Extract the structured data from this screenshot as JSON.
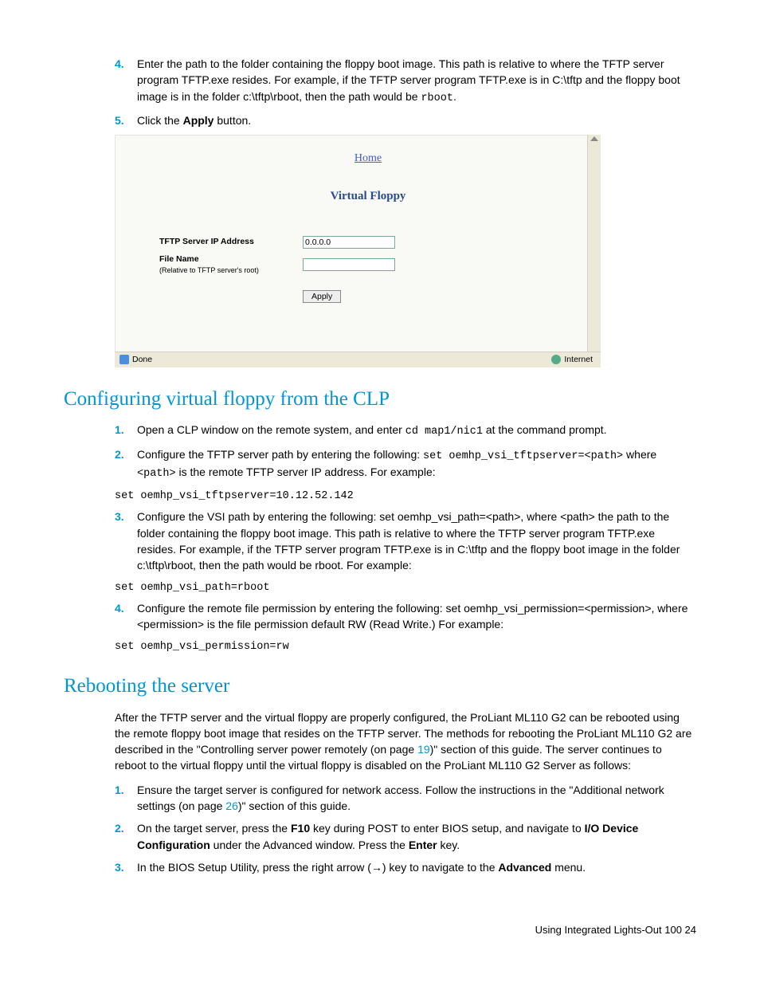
{
  "top": {
    "item4_a": "Enter the path to the folder containing the floppy boot image. This path is relative to where the TFTP server program TFTP.exe resides. For example, if the TFTP server program TFTP.exe is in C:\\tftp and the floppy boot image is in the folder c:\\tftp\\rboot, then the path would be ",
    "item4_code": "rboot",
    "item4_b": ".",
    "item5_a": "Click the ",
    "item5_bold": "Apply",
    "item5_b": " button."
  },
  "embed": {
    "home": "Home",
    "title": "Virtual Floppy",
    "label_ip": "TFTP Server IP Address",
    "label_file": "File Name",
    "label_file_sub": "(Relative to TFTP server's root)",
    "ip_value": "0.0.0.0",
    "apply": "Apply",
    "status_left": "Done",
    "status_right": "Internet"
  },
  "h2a": "Configuring virtual floppy from the CLP",
  "clp": {
    "i1a": "Open a CLP window on the remote system, and enter ",
    "i1code": "cd map1/nic1",
    "i1b": " at the command prompt.",
    "i2a": "Configure the TFTP server path by entering the following: ",
    "i2code": "set oemhp_vsi_tftpserver=<path>",
    "i2b": " where ",
    "i2code2": "<path>",
    "i2c": " is the remote TFTP server IP address. For example:",
    "code1": "set oemhp_vsi_tftpserver=10.12.52.142",
    "i3": "Configure the VSI path by entering the following: set oemhp_vsi_path=<path>,  where <path> the path to the folder containing the floppy boot image. This path is relative to where the TFTP server program TFTP.exe resides. For example, if the TFTP server program TFTP.exe is in C:\\tftp and the floppy boot image in the folder c:\\tftp\\rboot, then the path would be rboot. For example:",
    "code2": "set oemhp_vsi_path=rboot",
    "i4": "Configure the remote file permission by entering the following: set oemhp_vsi_permission=<permission>,  where <permission> is the file permission default RW (Read Write.) For example:",
    "code3": "set oemhp_vsi_permission=rw"
  },
  "h2b": "Rebooting the server",
  "reboot": {
    "p_a": "After the TFTP server and the virtual floppy are properly configured, the ProLiant ML110 G2 can be rebooted using the remote floppy boot image that resides on the TFTP server. The methods for rebooting the ProLiant ML110 G2 are described in the \"Controlling server power remotely (on page ",
    "p_link1": "19",
    "p_b": ")\" section of this guide. The server continues to reboot to the virtual floppy until the virtual floppy is disabled on the ProLiant ML110 G2 Server as follows:",
    "i1a": "Ensure the target server is configured for network access. Follow the instructions in the \"Additional network settings (on page ",
    "i1link": "26",
    "i1b": ")\" section of this guide.",
    "i2a": "On the target server, press the ",
    "i2b1": "F10",
    "i2c": " key during POST to enter BIOS setup, and navigate to ",
    "i2b2": "I/O Device Configuration",
    "i2d": " under the Advanced window. Press the ",
    "i2b3": "Enter",
    "i2e": " key.",
    "i3a": "In the BIOS Setup Utility, press the right arrow (→) key to navigate to the ",
    "i3b": "Advanced",
    "i3c": " menu."
  },
  "footer": "Using Integrated Lights-Out 100   24"
}
